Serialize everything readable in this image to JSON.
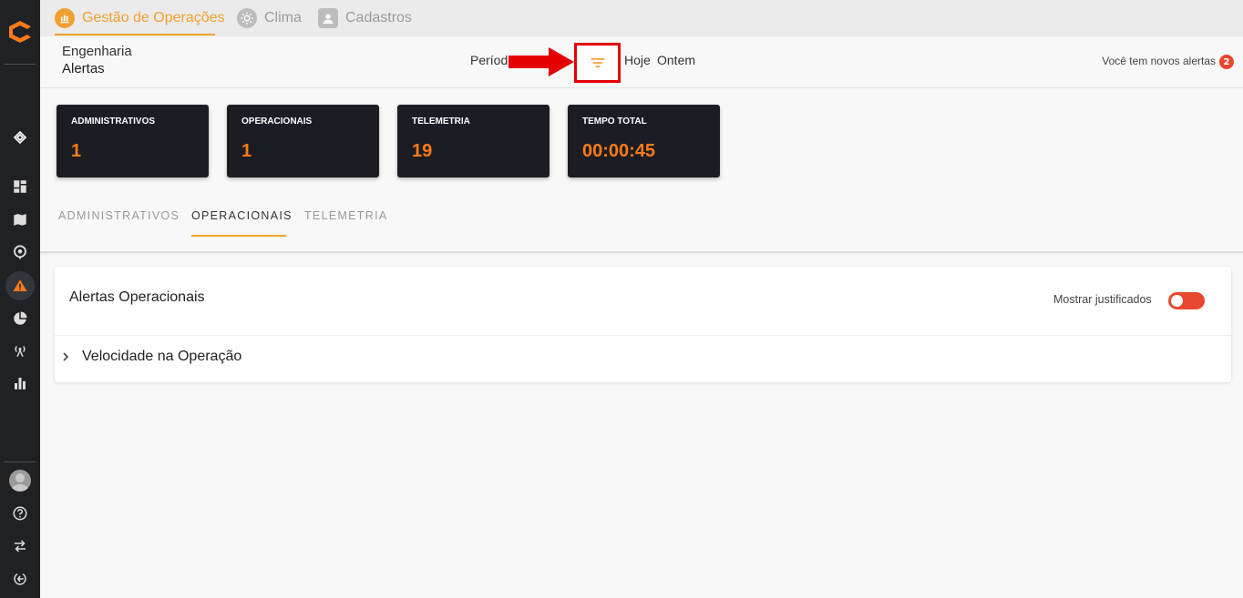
{
  "top_tabs": [
    {
      "label": "Gestão de Operações",
      "icon": "chart-hand-icon",
      "active": true
    },
    {
      "label": "Clima",
      "icon": "sun-icon",
      "active": false
    },
    {
      "label": "Cadastros",
      "icon": "user-icon",
      "active": false
    }
  ],
  "breadcrumb": {
    "section": "Engenharia",
    "page": "Alertas"
  },
  "period": {
    "label": "Período",
    "today": "Hoje",
    "yesterday": "Ontem"
  },
  "alerts_notice": {
    "text": "Você tem novos alertas",
    "count": "2"
  },
  "stats": [
    {
      "label": "ADMINISTRATIVOS",
      "value": "1"
    },
    {
      "label": "OPERACIONAIS",
      "value": "1"
    },
    {
      "label": "TELEMETRIA",
      "value": "19"
    },
    {
      "label": "TEMPO TOTAL",
      "value": "00:00:45"
    }
  ],
  "section_tabs": [
    {
      "label": "ADMINISTRATIVOS",
      "active": false
    },
    {
      "label": "OPERACIONAIS",
      "active": true
    },
    {
      "label": "TELEMETRIA",
      "active": false
    }
  ],
  "panel": {
    "title": "Alertas Operacionais",
    "toggle_label": "Mostrar justificados",
    "rows": [
      {
        "label": "Velocidade na Operação"
      }
    ]
  },
  "colors": {
    "accent": "#f0a030",
    "value_orange": "#ff7a1a",
    "alert_red": "#e8482f",
    "highlight_red": "#e40000"
  }
}
